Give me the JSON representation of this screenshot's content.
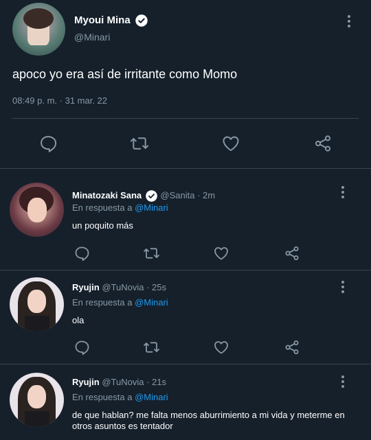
{
  "main_tweet": {
    "display_name": "Myoui Mina",
    "handle": "@Minari",
    "text": "apoco yo era así de irritante como Momo",
    "timestamp": "08:49 p. m. · 31 mar. 22"
  },
  "replies": [
    {
      "display_name": "Minatozaki Sana",
      "handle": "@Sanita",
      "time": "· 2m",
      "verified": true,
      "reply_prefix": "En respuesta a",
      "reply_to": "@Minari",
      "text": "un poquito más"
    },
    {
      "display_name": "Ryujin",
      "handle": "@TuNovia",
      "time": "· 25s",
      "verified": false,
      "reply_prefix": "En respuesta a",
      "reply_to": "@Minari",
      "text": "ola"
    },
    {
      "display_name": "Ryujin",
      "handle": "@TuNovia",
      "time": "· 21s",
      "verified": false,
      "reply_prefix": "En respuesta a",
      "reply_to": "@Minari",
      "text": "de que hablan? me falta menos aburrimiento a mi vida y meterme en otros asuntos es tentador"
    }
  ],
  "icons": [
    "reply-icon",
    "retweet-icon",
    "like-icon",
    "share-icon",
    "more-icon",
    "verified-icon"
  ],
  "colors": {
    "background": "#15202b",
    "muted": "#8899a6",
    "link": "#1d9bf0",
    "divider": "#38444d"
  }
}
